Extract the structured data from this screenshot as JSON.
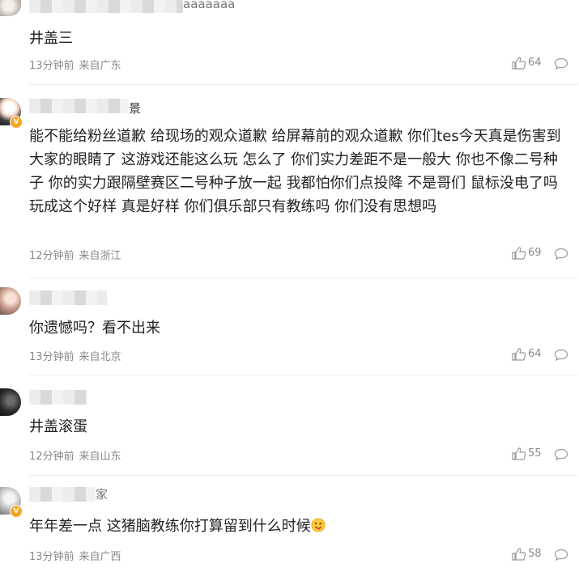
{
  "comments": [
    {
      "name_tail": "aaaaaaa",
      "text": "井盖三",
      "time": "13分钟前",
      "location": "来自广东",
      "likes": "64",
      "verified": false
    },
    {
      "name_tail": "景",
      "text": "能不能给粉丝道歉 给现场的观众道歉 给屏幕前的观众道歉 你们tes今天真是伤害到大家的眼睛了 这游戏还能这么玩 怎么了 你们实力差距不是一般大 你也不像二号种子 你的实力跟隔壁赛区二号种子放一起 我都怕你们点投降 不是哥们 鼠标没电了吗 玩成这个好样 真是好样 你们俱乐部只有教练吗 你们没有思想吗",
      "time": "12分钟前",
      "location": "来自浙江",
      "likes": "69",
      "verified": true
    },
    {
      "name_tail": "",
      "text": "你遗憾吗？看不出来",
      "time": "13分钟前",
      "location": "来自北京",
      "likes": "64",
      "verified": false
    },
    {
      "name_tail": "",
      "text": "井盖滚蛋",
      "time": "12分钟前",
      "location": "来自山东",
      "likes": "55",
      "verified": false
    },
    {
      "name_tail": "家",
      "text": "年年差一点 这猪脑教练你打算留到什么时候",
      "time": "13分钟前",
      "location": "来自广西",
      "likes": "58",
      "verified": true
    }
  ],
  "icons": {
    "like": "thumbs-up-icon",
    "reply": "comment-bubble-icon",
    "verified": "verified-badge-icon",
    "emoji": "tongue-out-emoji-icon"
  },
  "colors": {
    "meta": "#888888",
    "text": "#222222",
    "divider": "#ececec",
    "badge": "#f5a623"
  }
}
